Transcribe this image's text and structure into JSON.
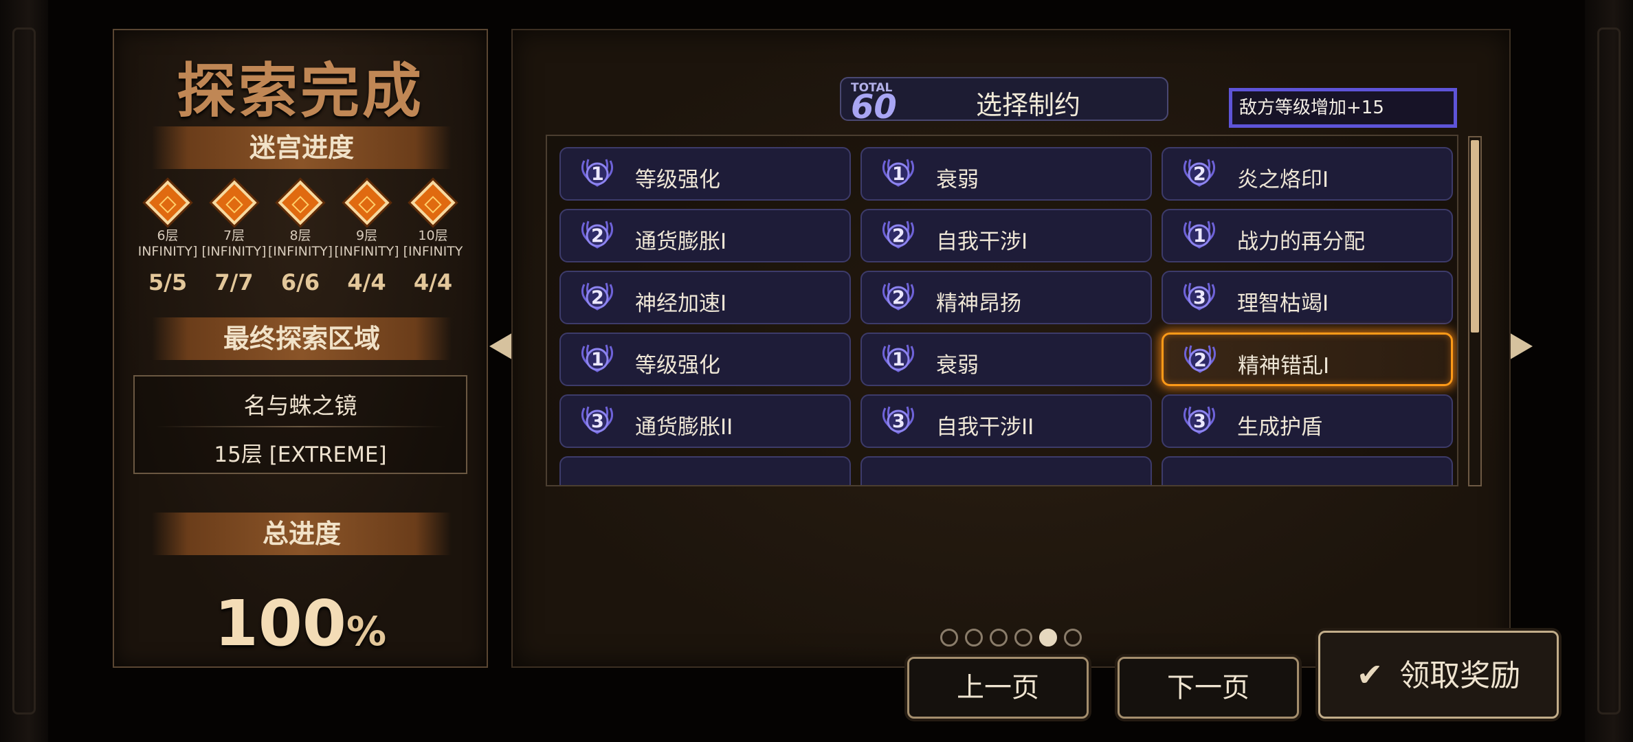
{
  "left_panel": {
    "title": "探索完成",
    "maze_progress_label": "迷宫进度",
    "floors": [
      {
        "name": "6层",
        "difficulty": "INFINITY]",
        "count": "5/5"
      },
      {
        "name": "7层",
        "difficulty": "[INFINITY]",
        "count": "7/7"
      },
      {
        "name": "8层",
        "difficulty": "[INFINITY]",
        "count": "6/6"
      },
      {
        "name": "9层",
        "difficulty": "[INFINITY]",
        "count": "4/4"
      },
      {
        "name": "10层",
        "difficulty": "[INFINITY",
        "count": "4/4"
      }
    ],
    "final_area_label": "最终探索区域",
    "final_area_name": "名与蛛之镜",
    "final_area_floor": "15层 [EXTREME]",
    "total_progress_label": "总进度",
    "total_progress_value": "100",
    "total_progress_unit": "%"
  },
  "right_panel": {
    "total_label": "TOTAL",
    "total_value": "60",
    "header_title": "选择制约",
    "level_info": "敌方等级增加+15",
    "constraints": [
      {
        "level": "1",
        "label": "等级强化"
      },
      {
        "level": "1",
        "label": "衰弱"
      },
      {
        "level": "2",
        "label": "炎之烙印I"
      },
      {
        "level": "2",
        "label": "通货膨胀I"
      },
      {
        "level": "2",
        "label": "自我干涉I"
      },
      {
        "level": "1",
        "label": "战力的再分配"
      },
      {
        "level": "2",
        "label": "神经加速I"
      },
      {
        "level": "2",
        "label": "精神昂扬"
      },
      {
        "level": "3",
        "label": "理智枯竭I"
      },
      {
        "level": "1",
        "label": "等级强化"
      },
      {
        "level": "1",
        "label": "衰弱"
      },
      {
        "level": "2",
        "label": "精神错乱I",
        "selected": true
      },
      {
        "level": "3",
        "label": "通货膨胀II"
      },
      {
        "level": "3",
        "label": "自我干涉II"
      },
      {
        "level": "3",
        "label": "生成护盾"
      }
    ],
    "page_count": 6,
    "active_page": 5,
    "scroll_position": 0.0
  },
  "buttons": {
    "prev_label": "上一页",
    "next_label": "下一页",
    "claim_label": "领取奖励",
    "claim_icon": "check-icon"
  },
  "colors": {
    "accent_orange": "#ff9a18",
    "tile_bg": "#1e1c38",
    "level_border": "#5e54d8",
    "title_brown": "#c08755"
  }
}
